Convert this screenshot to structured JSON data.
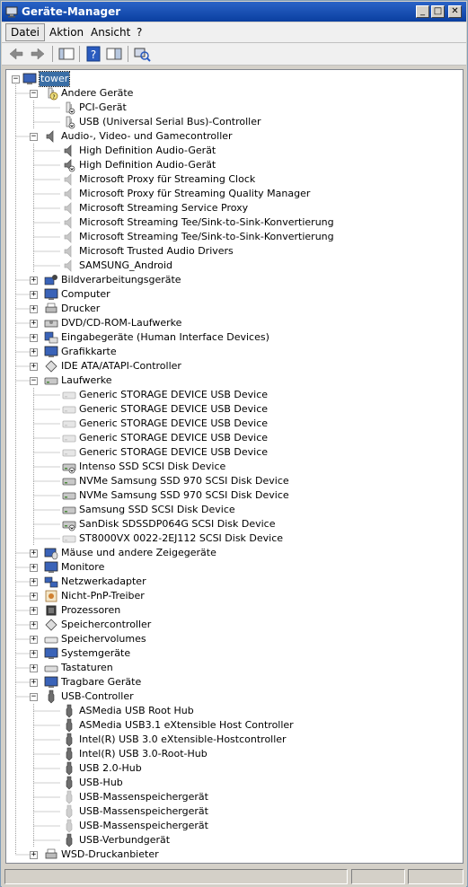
{
  "window": {
    "title": "Geräte-Manager"
  },
  "menu": {
    "items": [
      "Datei",
      "Aktion",
      "Ansicht",
      "?"
    ]
  },
  "tree": {
    "root": "tower",
    "groups": [
      {
        "label": "Andere Geräte",
        "expanded": true,
        "icon": "unknown-device-icon",
        "children": [
          {
            "label": "PCI-Gerät",
            "icon": "warning-device-icon"
          },
          {
            "label": "USB (Universal Serial Bus)-Controller",
            "icon": "warning-device-icon"
          }
        ]
      },
      {
        "label": "Audio-, Video- und Gamecontroller",
        "expanded": true,
        "icon": "speaker-icon",
        "children": [
          {
            "label": "High Definition Audio-Gerät",
            "icon": "speaker-icon"
          },
          {
            "label": "High Definition Audio-Gerät",
            "icon": "speaker-disabled-icon"
          },
          {
            "label": "Microsoft Proxy für Streaming Clock",
            "icon": "speaker-gray-icon"
          },
          {
            "label": "Microsoft Proxy für Streaming Quality Manager",
            "icon": "speaker-gray-icon"
          },
          {
            "label": "Microsoft Streaming Service Proxy",
            "icon": "speaker-gray-icon"
          },
          {
            "label": "Microsoft Streaming Tee/Sink-to-Sink-Konvertierung",
            "icon": "speaker-gray-icon"
          },
          {
            "label": "Microsoft Streaming Tee/Sink-to-Sink-Konvertierung",
            "icon": "speaker-gray-icon"
          },
          {
            "label": "Microsoft Trusted Audio Drivers",
            "icon": "speaker-gray-icon"
          },
          {
            "label": "SAMSUNG_Android",
            "icon": "speaker-gray-icon"
          }
        ]
      },
      {
        "label": "Bildverarbeitungsgeräte",
        "expanded": false,
        "icon": "camera-icon",
        "children": []
      },
      {
        "label": "Computer",
        "expanded": false,
        "icon": "computer-icon",
        "children": []
      },
      {
        "label": "Drucker",
        "expanded": false,
        "icon": "printer-icon",
        "children": []
      },
      {
        "label": "DVD/CD-ROM-Laufwerke",
        "expanded": false,
        "icon": "disc-drive-icon",
        "children": []
      },
      {
        "label": "Eingabegeräte (Human Interface Devices)",
        "expanded": false,
        "icon": "hid-icon",
        "children": []
      },
      {
        "label": "Grafikkarte",
        "expanded": false,
        "icon": "display-adapter-icon",
        "children": []
      },
      {
        "label": "IDE ATA/ATAPI-Controller",
        "expanded": false,
        "icon": "ide-controller-icon",
        "children": []
      },
      {
        "label": "Laufwerke",
        "expanded": true,
        "icon": "disk-drive-icon",
        "children": [
          {
            "label": "Generic STORAGE DEVICE USB Device",
            "icon": "disk-gray-icon"
          },
          {
            "label": "Generic STORAGE DEVICE USB Device",
            "icon": "disk-gray-icon"
          },
          {
            "label": "Generic STORAGE DEVICE USB Device",
            "icon": "disk-gray-icon"
          },
          {
            "label": "Generic STORAGE DEVICE USB Device",
            "icon": "disk-gray-icon"
          },
          {
            "label": "Generic STORAGE DEVICE USB Device",
            "icon": "disk-gray-icon"
          },
          {
            "label": "Intenso SSD SCSI Disk Device",
            "icon": "disk-disabled-icon"
          },
          {
            "label": "NVMe Samsung SSD 970 SCSI Disk Device",
            "icon": "disk-drive-icon"
          },
          {
            "label": "NVMe Samsung SSD 970 SCSI Disk Device",
            "icon": "disk-drive-icon"
          },
          {
            "label": "Samsung SSD SCSI Disk Device",
            "icon": "disk-drive-icon"
          },
          {
            "label": "SanDisk SDSSDP064G SCSI Disk Device",
            "icon": "disk-disabled-icon"
          },
          {
            "label": "ST8000VX 0022-2EJ112 SCSI Disk Device",
            "icon": "disk-gray-icon"
          }
        ]
      },
      {
        "label": "Mäuse und andere Zeigegeräte",
        "expanded": false,
        "icon": "mouse-icon",
        "children": []
      },
      {
        "label": "Monitore",
        "expanded": false,
        "icon": "monitor-icon",
        "children": []
      },
      {
        "label": "Netzwerkadapter",
        "expanded": false,
        "icon": "network-adapter-icon",
        "children": []
      },
      {
        "label": "Nicht-PnP-Treiber",
        "expanded": false,
        "icon": "non-pnp-driver-icon",
        "children": []
      },
      {
        "label": "Prozessoren",
        "expanded": false,
        "icon": "processor-icon",
        "children": []
      },
      {
        "label": "Speichercontroller",
        "expanded": false,
        "icon": "storage-controller-icon",
        "children": []
      },
      {
        "label": "Speichervolumes",
        "expanded": false,
        "icon": "storage-volume-icon",
        "children": []
      },
      {
        "label": "Systemgeräte",
        "expanded": false,
        "icon": "system-device-icon",
        "children": []
      },
      {
        "label": "Tastaturen",
        "expanded": false,
        "icon": "keyboard-icon",
        "children": []
      },
      {
        "label": "Tragbare Geräte",
        "expanded": false,
        "icon": "portable-device-icon",
        "children": []
      },
      {
        "label": "USB-Controller",
        "expanded": true,
        "icon": "usb-icon",
        "children": [
          {
            "label": "ASMedia USB Root Hub",
            "icon": "usb-icon"
          },
          {
            "label": "ASMedia USB3.1 eXtensible Host Controller",
            "icon": "usb-icon"
          },
          {
            "label": "Intel(R) USB 3.0 eXtensible-Hostcontroller",
            "icon": "usb-icon"
          },
          {
            "label": "Intel(R) USB 3.0-Root-Hub",
            "icon": "usb-icon"
          },
          {
            "label": "USB 2.0-Hub",
            "icon": "usb-icon"
          },
          {
            "label": "USB-Hub",
            "icon": "usb-icon"
          },
          {
            "label": "USB-Massenspeichergerät",
            "icon": "usb-gray-icon"
          },
          {
            "label": "USB-Massenspeichergerät",
            "icon": "usb-gray-icon"
          },
          {
            "label": "USB-Massenspeichergerät",
            "icon": "usb-gray-icon"
          },
          {
            "label": "USB-Verbundgerät",
            "icon": "usb-icon"
          }
        ]
      },
      {
        "label": "WSD-Druckanbieter",
        "expanded": false,
        "icon": "printer-icon",
        "children": []
      }
    ]
  }
}
